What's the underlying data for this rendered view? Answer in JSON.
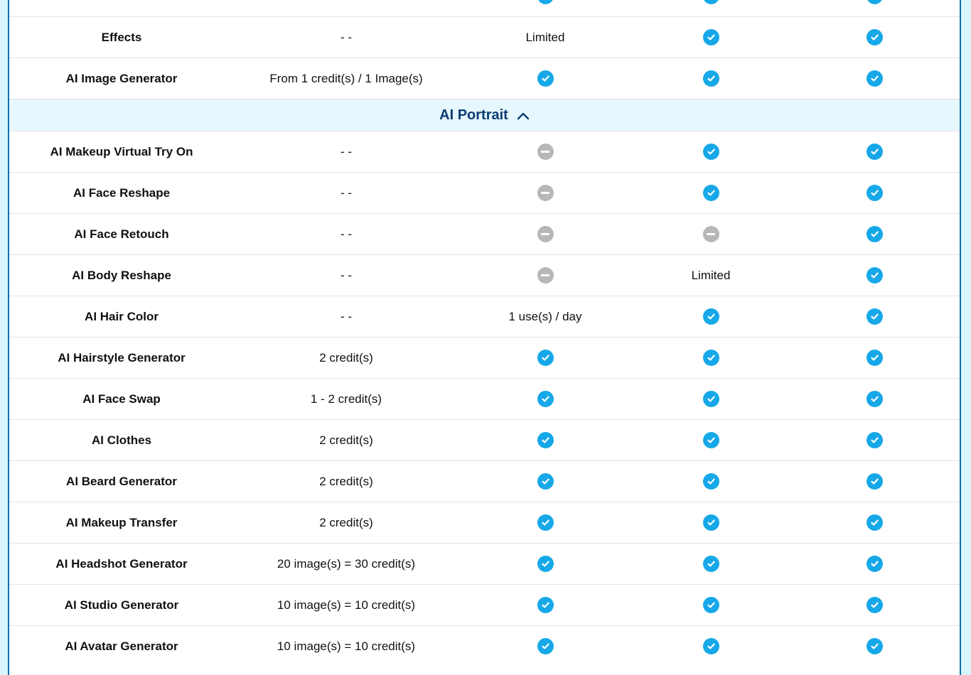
{
  "rows_top": [
    {
      "feature": "Effects",
      "price": "- -",
      "c1": {
        "type": "text",
        "value": "Limited"
      },
      "c2": {
        "type": "check"
      },
      "c3": {
        "type": "check"
      }
    },
    {
      "feature": "AI Image Generator",
      "price": "From 1 credit(s) / 1 Image(s)",
      "c1": {
        "type": "check"
      },
      "c2": {
        "type": "check"
      },
      "c3": {
        "type": "check"
      }
    }
  ],
  "section": {
    "title": "AI Portrait",
    "icon": "chevron-up-icon"
  },
  "rows_portrait": [
    {
      "feature": "AI Makeup Virtual Try On",
      "price": "- -",
      "c1": {
        "type": "minus"
      },
      "c2": {
        "type": "check"
      },
      "c3": {
        "type": "check"
      }
    },
    {
      "feature": "AI Face Reshape",
      "price": "- -",
      "c1": {
        "type": "minus"
      },
      "c2": {
        "type": "check"
      },
      "c3": {
        "type": "check"
      }
    },
    {
      "feature": "AI Face Retouch",
      "price": "- -",
      "c1": {
        "type": "minus"
      },
      "c2": {
        "type": "minus"
      },
      "c3": {
        "type": "check"
      }
    },
    {
      "feature": "AI Body Reshape",
      "price": "- -",
      "c1": {
        "type": "minus"
      },
      "c2": {
        "type": "text",
        "value": "Limited"
      },
      "c3": {
        "type": "check"
      }
    },
    {
      "feature": "AI Hair Color",
      "price": "- -",
      "c1": {
        "type": "text",
        "value": "1 use(s) / day"
      },
      "c2": {
        "type": "check"
      },
      "c3": {
        "type": "check"
      }
    },
    {
      "feature": "AI Hairstyle Generator",
      "price": "2 credit(s)",
      "c1": {
        "type": "check"
      },
      "c2": {
        "type": "check"
      },
      "c3": {
        "type": "check"
      }
    },
    {
      "feature": "AI Face Swap",
      "price": "1 - 2 credit(s)",
      "c1": {
        "type": "check"
      },
      "c2": {
        "type": "check"
      },
      "c3": {
        "type": "check"
      }
    },
    {
      "feature": "AI Clothes",
      "price": "2 credit(s)",
      "c1": {
        "type": "check"
      },
      "c2": {
        "type": "check"
      },
      "c3": {
        "type": "check"
      }
    },
    {
      "feature": "AI Beard Generator",
      "price": "2 credit(s)",
      "c1": {
        "type": "check"
      },
      "c2": {
        "type": "check"
      },
      "c3": {
        "type": "check"
      }
    },
    {
      "feature": "AI Makeup Transfer",
      "price": "2 credit(s)",
      "c1": {
        "type": "check"
      },
      "c2": {
        "type": "check"
      },
      "c3": {
        "type": "check"
      }
    },
    {
      "feature": "AI Headshot Generator",
      "price": "20 image(s) = 30 credit(s)",
      "c1": {
        "type": "check"
      },
      "c2": {
        "type": "check"
      },
      "c3": {
        "type": "check"
      }
    },
    {
      "feature": "AI Studio Generator",
      "price": "10 image(s) = 10 credit(s)",
      "c1": {
        "type": "check"
      },
      "c2": {
        "type": "check"
      },
      "c3": {
        "type": "check"
      }
    },
    {
      "feature": "AI Avatar Generator",
      "price": "10 image(s) = 10 credit(s)",
      "c1": {
        "type": "check"
      },
      "c2": {
        "type": "check"
      },
      "c3": {
        "type": "check"
      }
    }
  ],
  "colors": {
    "accent": "#16a8e8",
    "section_bg": "#e6f8fd",
    "section_text": "#0b3a73",
    "frame_border": "#0a6fb4",
    "page_bg": "#d8f6fb",
    "unavailable": "#b7b7b7"
  }
}
